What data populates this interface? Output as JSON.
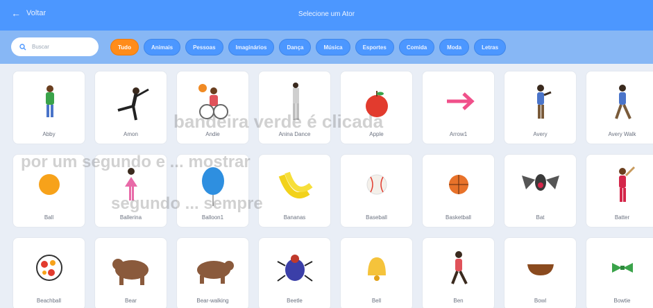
{
  "header": {
    "back_label": "Voltar",
    "title": "Selecione um Ator"
  },
  "search": {
    "placeholder": "Buscar"
  },
  "filters": [
    {
      "label": "Tudo",
      "active": true
    },
    {
      "label": "Animais"
    },
    {
      "label": "Pessoas"
    },
    {
      "label": "Imaginários"
    },
    {
      "label": "Dança"
    },
    {
      "label": "Música"
    },
    {
      "label": "Esportes"
    },
    {
      "label": "Comida"
    },
    {
      "label": "Moda"
    },
    {
      "label": "Letras"
    }
  ],
  "sprites": [
    {
      "name": "Abby",
      "icon": "abby"
    },
    {
      "name": "Amon",
      "icon": "amon"
    },
    {
      "name": "Andie",
      "icon": "andie"
    },
    {
      "name": "Anina Dance",
      "icon": "anina-dance"
    },
    {
      "name": "Apple",
      "icon": "apple"
    },
    {
      "name": "Arrow1",
      "icon": "arrow"
    },
    {
      "name": "Avery",
      "icon": "avery"
    },
    {
      "name": "Avery Walk",
      "icon": "avery-walk"
    },
    {
      "name": "Ball",
      "icon": "ball"
    },
    {
      "name": "Ballerina",
      "icon": "ballerina"
    },
    {
      "name": "Balloon1",
      "icon": "balloon"
    },
    {
      "name": "Bananas",
      "icon": "bananas"
    },
    {
      "name": "Baseball",
      "icon": "baseball"
    },
    {
      "name": "Basketball",
      "icon": "basketball"
    },
    {
      "name": "Bat",
      "icon": "bat"
    },
    {
      "name": "Batter",
      "icon": "batter"
    },
    {
      "name": "Beachball",
      "icon": "beachball"
    },
    {
      "name": "Bear",
      "icon": "bear"
    },
    {
      "name": "Bear-walking",
      "icon": "bear-walking"
    },
    {
      "name": "Beetle",
      "icon": "beetle"
    },
    {
      "name": "Bell",
      "icon": "bell"
    },
    {
      "name": "Ben",
      "icon": "ben"
    },
    {
      "name": "Bowl",
      "icon": "bowl"
    },
    {
      "name": "Bowtie",
      "icon": "bowtie"
    }
  ],
  "overlay_text": [
    "bandeira verde é clicada",
    "por um segundo e ... mostrar",
    "segundo ... sempre"
  ]
}
